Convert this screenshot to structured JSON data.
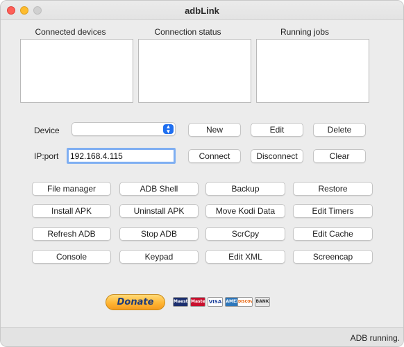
{
  "window": {
    "title": "adbLink"
  },
  "panels": {
    "connected_devices": "Connected devices",
    "connection_status": "Connection status",
    "running_jobs": "Running jobs"
  },
  "device_row": {
    "label": "Device",
    "selected": "",
    "new": "New",
    "edit": "Edit",
    "delete": "Delete"
  },
  "ip_row": {
    "label": "IP:port",
    "value": "192.168.4.115",
    "connect": "Connect",
    "disconnect": "Disconnect",
    "clear": "Clear"
  },
  "actions": {
    "file_manager": "File manager",
    "adb_shell": "ADB Shell",
    "backup": "Backup",
    "restore": "Restore",
    "install_apk": "Install APK",
    "uninstall_apk": "Uninstall APK",
    "move_kodi_data": "Move Kodi Data",
    "edit_timers": "Edit Timers",
    "refresh_adb": "Refresh ADB",
    "stop_adb": "Stop ADB",
    "scrcpy": "ScrCpy",
    "edit_cache": "Edit Cache",
    "console": "Console",
    "keypad": "Keypad",
    "edit_xml": "Edit XML",
    "screencap": "Screencap"
  },
  "donate": {
    "label": "Donate",
    "cards": [
      "Maestro",
      "MasterCard",
      "VISA",
      "AMEX",
      "DISCOVER",
      "BANK"
    ]
  },
  "status": {
    "text": "ADB running."
  },
  "colors": {
    "accent": "#1f6ff0",
    "close": "#fe5f57",
    "minimize": "#febc2e",
    "donate": "#ffb634"
  }
}
